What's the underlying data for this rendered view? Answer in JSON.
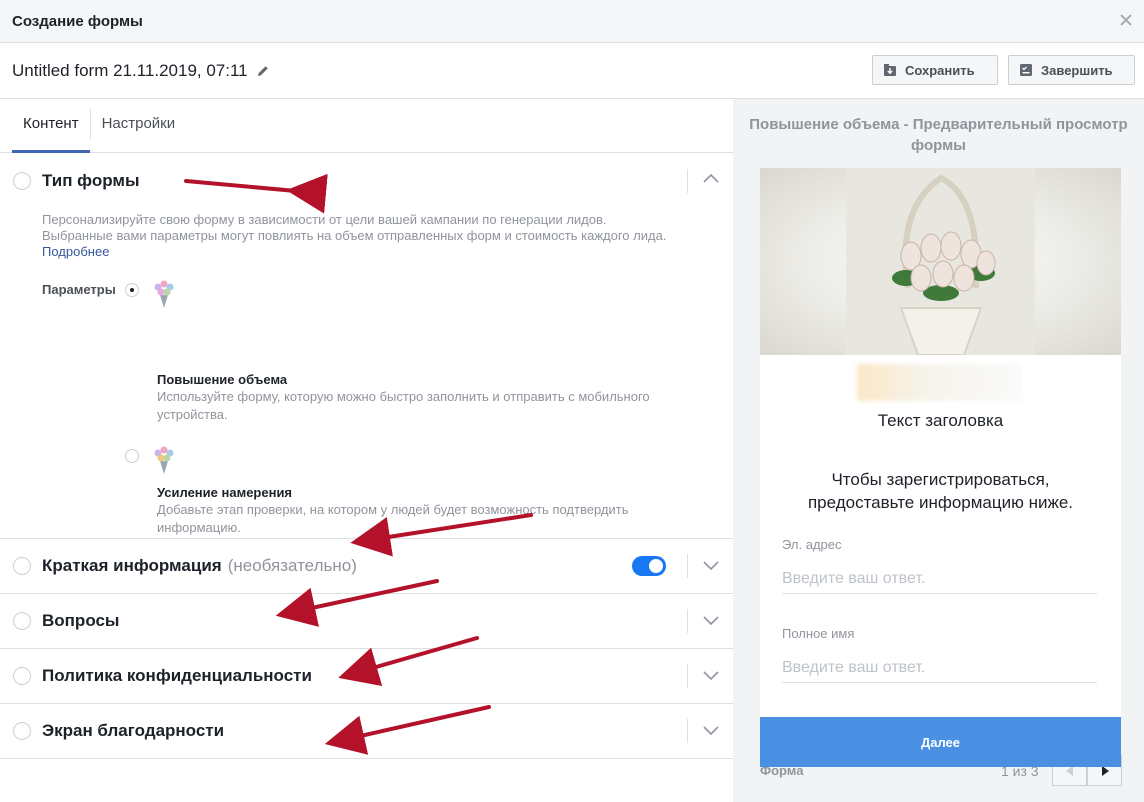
{
  "dialog": {
    "title": "Создание формы"
  },
  "form": {
    "name": "Untitled form 21.11.2019, 07:11"
  },
  "toolbar": {
    "save_label": "Сохранить",
    "finish_label": "Завершить"
  },
  "tabs": [
    {
      "label": "Контент",
      "active": true
    },
    {
      "label": "Настройки",
      "active": false
    }
  ],
  "form_type": {
    "title": "Тип формы",
    "description": "Персонализируйте свою форму в зависимости от цели вашей кампании по генерации лидов. Выбранные вами параметры могут повлиять на объем отправленных форм и стоимость каждого лида.",
    "learn_more": "Подробнее",
    "params_label": "Параметры",
    "options": [
      {
        "title": "Повышение объема",
        "description": "Используйте форму, которую можно быстро заполнить и отправить с мобильного устройства.",
        "selected": true
      },
      {
        "title": "Усиление намерения",
        "description": "Добавьте этап проверки, на котором у людей будет возможность подтвердить информацию.",
        "selected": false
      }
    ]
  },
  "sections": {
    "intro": {
      "title": "Краткая информация",
      "optional": "(необязательно)",
      "toggle_on": true
    },
    "questions": {
      "title": "Вопросы"
    },
    "privacy": {
      "title": "Политика конфиденциальности"
    },
    "thanks": {
      "title": "Экран благодарности"
    }
  },
  "preview": {
    "title": "Повышение объема - Предварительный просмотр формы",
    "headline": "Текст заголовка",
    "intro": "Чтобы зарегистрироваться, предоставьте информацию ниже.",
    "fields": [
      {
        "label": "Эл. адрес",
        "placeholder": "Введите ваш ответ."
      },
      {
        "label": "Полное имя",
        "placeholder": "Введите ваш ответ."
      }
    ],
    "next_label": "Далее",
    "pager_label": "Форма",
    "pager_count": "1 из 3"
  },
  "colors": {
    "accent": "#4267b2",
    "annotation_arrow": "#b3122a",
    "next_button": "#4a90e2",
    "toggle": "#1877f2"
  }
}
